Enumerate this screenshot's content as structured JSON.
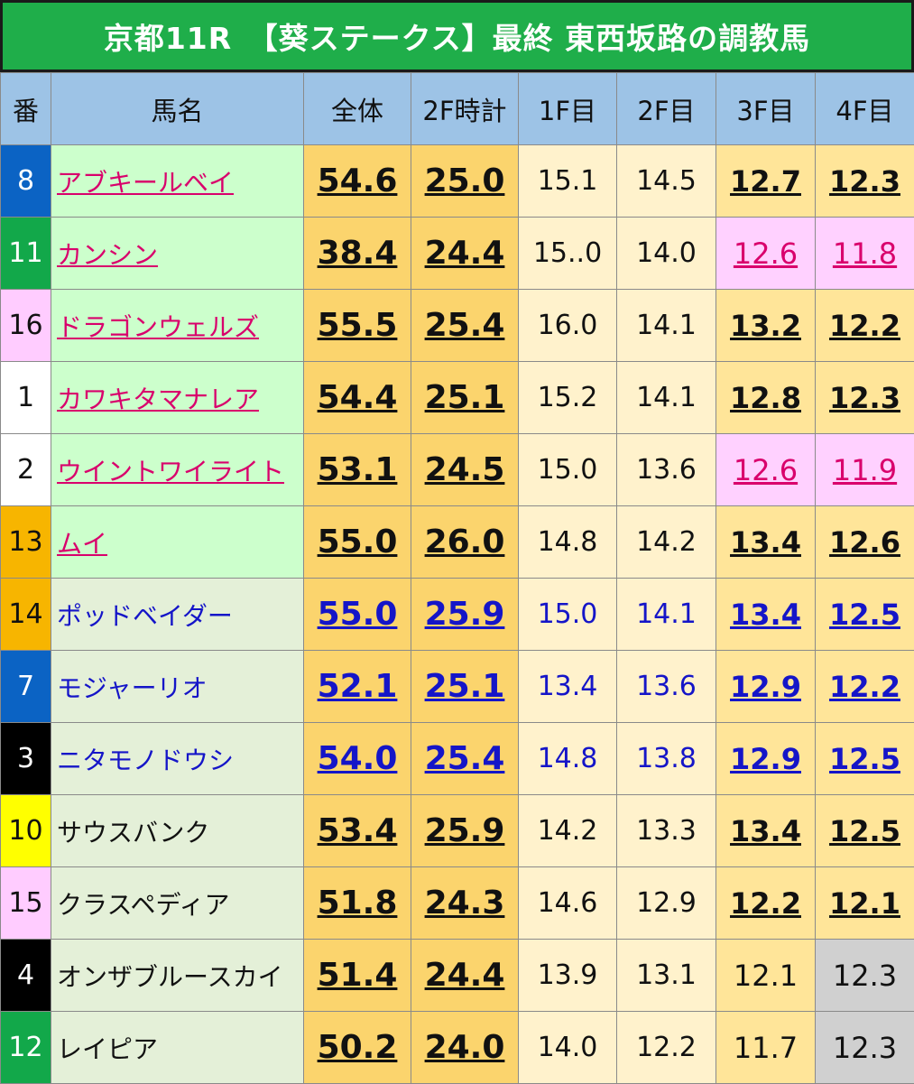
{
  "title": "京都11R　【葵ステークス】最終 東西坂路の調教馬",
  "headers": [
    "番",
    "馬名",
    "全体",
    "2F時計",
    "1F目",
    "2F目",
    "3F目",
    "4F目"
  ],
  "colors": {
    "title_bg": "#1fae4a",
    "header_bg": "#9dc3e6",
    "name_green": "#ccffcc",
    "name_pale": "#e4f0d8",
    "big_cell": "#fbd46d",
    "light_cell": "#fff2cc",
    "mid_cell": "#ffe599",
    "pink_cell": "#ffd1ff",
    "gray_cell": "#d0d0d0",
    "pink_text": "#d9006c",
    "blue_text": "#1515c8"
  },
  "rows": [
    {
      "num": "8",
      "name": "アブキールベイ",
      "total": "54.6",
      "f2": "25.0",
      "s1": "15.1",
      "s2": "14.5",
      "s3": "12.7",
      "s4": "12.3",
      "num_bg": "#0b63c4",
      "num_fg": "#ffffff",
      "name_color": "pink",
      "name_bg": "green",
      "color": "black",
      "s34": "bold",
      "highlight": ""
    },
    {
      "num": "11",
      "name": "カンシン",
      "total": "38.4",
      "f2": "24.4",
      "s1": "15..0",
      "s2": "14.0",
      "s3": "12.6",
      "s4": "11.8",
      "num_bg": "#12a84a",
      "num_fg": "#ffffff",
      "name_color": "pink",
      "name_bg": "green",
      "color": "black",
      "s34": "pinkul",
      "highlight": "pink"
    },
    {
      "num": "16",
      "name": "ドラゴンウェルズ",
      "total": "55.5",
      "f2": "25.4",
      "s1": "16.0",
      "s2": "14.1",
      "s3": "13.2",
      "s4": "12.2",
      "num_bg": "#ffccff",
      "num_fg": "#111111",
      "name_color": "pink",
      "name_bg": "green",
      "color": "black",
      "s34": "bold",
      "highlight": ""
    },
    {
      "num": "1",
      "name": "カワキタマナレア",
      "total": "54.4",
      "f2": "25.1",
      "s1": "15.2",
      "s2": "14.1",
      "s3": "12.8",
      "s4": "12.3",
      "num_bg": "#ffffff",
      "num_fg": "#111111",
      "name_color": "pink",
      "name_bg": "green",
      "color": "black",
      "s34": "bold",
      "highlight": ""
    },
    {
      "num": "2",
      "name": "ウイントワイライト",
      "total": "53.1",
      "f2": "24.5",
      "s1": "15.0",
      "s2": "13.6",
      "s3": "12.6",
      "s4": "11.9",
      "num_bg": "#ffffff",
      "num_fg": "#111111",
      "name_color": "pink",
      "name_bg": "green",
      "color": "black",
      "s34": "pinkul",
      "highlight": "pink"
    },
    {
      "num": "13",
      "name": "ムイ",
      "total": "55.0",
      "f2": "26.0",
      "s1": "14.8",
      "s2": "14.2",
      "s3": "13.4",
      "s4": "12.6",
      "num_bg": "#f7b500",
      "num_fg": "#111111",
      "name_color": "pink",
      "name_bg": "green",
      "color": "black",
      "s34": "bold",
      "highlight": ""
    },
    {
      "num": "14",
      "name": "ポッドベイダー",
      "total": "55.0",
      "f2": "25.9",
      "s1": "15.0",
      "s2": "14.1",
      "s3": "13.4",
      "s4": "12.5",
      "num_bg": "#f7b500",
      "num_fg": "#111111",
      "name_color": "blue",
      "name_bg": "pale",
      "color": "blue",
      "s34": "bold",
      "highlight": ""
    },
    {
      "num": "7",
      "name": "モジャーリオ",
      "total": "52.1",
      "f2": "25.1",
      "s1": "13.4",
      "s2": "13.6",
      "s3": "12.9",
      "s4": "12.2",
      "num_bg": "#0b63c4",
      "num_fg": "#ffffff",
      "name_color": "blue",
      "name_bg": "pale",
      "color": "blue",
      "s34": "bold",
      "highlight": ""
    },
    {
      "num": "3",
      "name": "ニタモノドウシ",
      "total": "54.0",
      "f2": "25.4",
      "s1": "14.8",
      "s2": "13.8",
      "s3": "12.9",
      "s4": "12.5",
      "num_bg": "#000000",
      "num_fg": "#ffffff",
      "name_color": "blue",
      "name_bg": "pale",
      "color": "blue",
      "s34": "bold",
      "highlight": ""
    },
    {
      "num": "10",
      "name": "サウスバンク",
      "total": "53.4",
      "f2": "25.9",
      "s1": "14.2",
      "s2": "13.3",
      "s3": "13.4",
      "s4": "12.5",
      "num_bg": "#ffff00",
      "num_fg": "#111111",
      "name_color": "black",
      "name_bg": "pale",
      "color": "black",
      "s34": "bold",
      "highlight": ""
    },
    {
      "num": "15",
      "name": "クラスペディア",
      "total": "51.8",
      "f2": "24.3",
      "s1": "14.6",
      "s2": "12.9",
      "s3": "12.2",
      "s4": "12.1",
      "num_bg": "#ffccff",
      "num_fg": "#111111",
      "name_color": "black",
      "name_bg": "pale",
      "color": "black",
      "s34": "bold",
      "highlight": ""
    },
    {
      "num": "4",
      "name": "オンザブルースカイ",
      "total": "51.4",
      "f2": "24.4",
      "s1": "13.9",
      "s2": "13.1",
      "s3": "12.1",
      "s4": "12.3",
      "num_bg": "#000000",
      "num_fg": "#ffffff",
      "name_color": "black",
      "name_bg": "pale",
      "color": "black",
      "s34": "plain",
      "highlight": "gray4"
    },
    {
      "num": "12",
      "name": "レイピア",
      "total": "50.2",
      "f2": "24.0",
      "s1": "14.0",
      "s2": "12.2",
      "s3": "11.7",
      "s4": "12.3",
      "num_bg": "#12a84a",
      "num_fg": "#ffffff",
      "name_color": "black",
      "name_bg": "pale",
      "color": "black",
      "s34": "plain",
      "highlight": "gray4"
    }
  ]
}
